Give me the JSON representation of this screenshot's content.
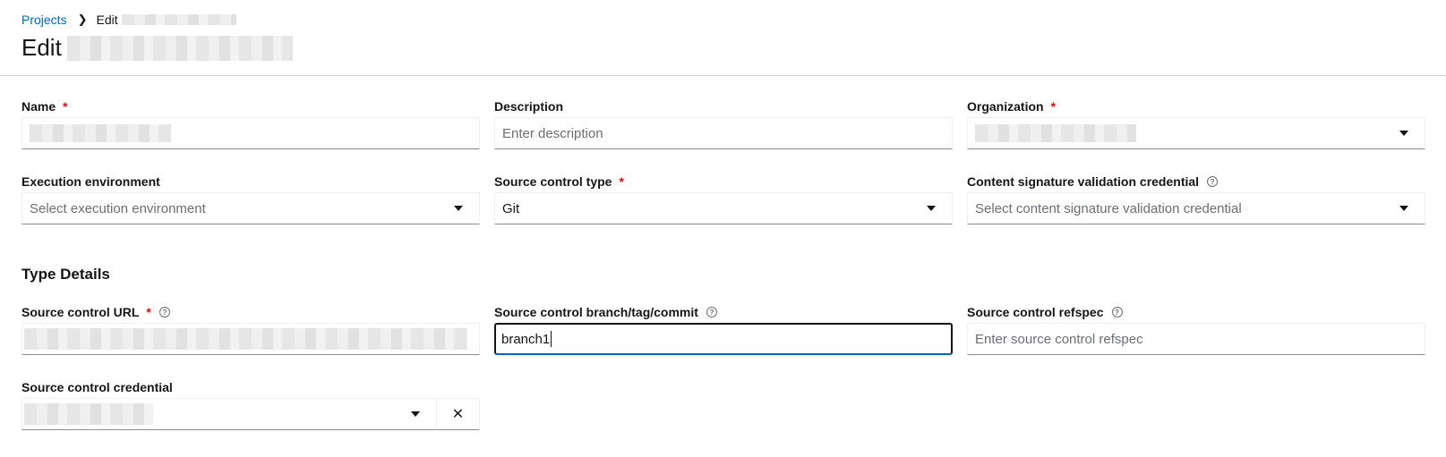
{
  "breadcrumb": {
    "root": "Projects",
    "current_prefix": "Edit"
  },
  "page": {
    "title_prefix": "Edit"
  },
  "fields": {
    "name": {
      "label": "Name",
      "required_mark": "*"
    },
    "description": {
      "label": "Description",
      "placeholder": "Enter description"
    },
    "organization": {
      "label": "Organization",
      "required_mark": "*"
    },
    "execution_environment": {
      "label": "Execution environment",
      "placeholder": "Select execution environment"
    },
    "source_control_type": {
      "label": "Source control type",
      "required_mark": "*",
      "value": "Git"
    },
    "content_signature": {
      "label": "Content signature validation credential",
      "help_icon": "?",
      "placeholder": "Select content signature validation credential"
    },
    "scm_url": {
      "label": "Source control URL",
      "required_mark": "*",
      "help_icon": "?"
    },
    "scm_branch": {
      "label": "Source control branch/tag/commit",
      "help_icon": "?",
      "value": "branch1"
    },
    "scm_refspec": {
      "label": "Source control refspec",
      "help_icon": "?",
      "placeholder": "Enter source control refspec"
    },
    "scm_credential": {
      "label": "Source control credential",
      "clear_icon": "✕"
    }
  },
  "sections": {
    "type_details": "Type Details"
  },
  "icons": {
    "breadcrumb_separator": "chevron-right-icon",
    "dropdown": "caret-down-icon",
    "help": "question-circle-icon",
    "clear": "times-icon"
  }
}
